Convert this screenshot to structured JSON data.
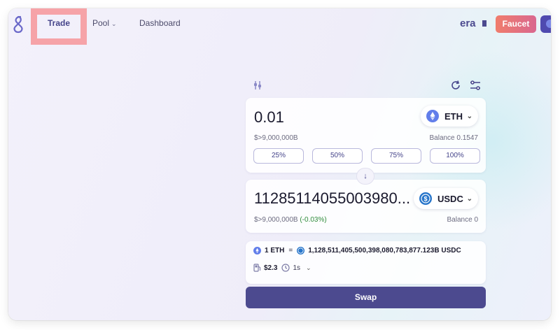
{
  "nav": {
    "items": [
      {
        "label": "Trade"
      },
      {
        "label": "Pool"
      },
      {
        "label": "Dashboard"
      }
    ],
    "faucet_label": "Faucet"
  },
  "swap": {
    "from": {
      "amount": "0.01",
      "token": "ETH",
      "usd_value": "$>9,000,000B",
      "balance_label": "Balance",
      "balance": "0.1547",
      "percent_buttons": [
        "25%",
        "50%",
        "75%",
        "100%"
      ]
    },
    "to": {
      "amount": "11285114055003980...",
      "token": "USDC",
      "usd_value": "$>9,000,000B",
      "price_impact": "(-0.03%)",
      "balance_label": "Balance",
      "balance": "0"
    },
    "rate": {
      "left": "1 ETH",
      "eq": "=",
      "right": "1,128,511,405,500,398,080,783,877.123B USDC"
    },
    "fee": "$2.3",
    "time": "1s",
    "button_label": "Swap"
  },
  "colors": {
    "accent": "#4c4a8f",
    "faucet_gradient_start": "#f07d6c",
    "faucet_gradient_end": "#d9678f",
    "eth": "#627eea",
    "usdc": "#2775ca",
    "positive": "#2e8b3a"
  },
  "icons": [
    "logo-icon",
    "era-logo",
    "chevron-down-icon",
    "sliders-icon",
    "refresh-icon",
    "settings-icon",
    "eth-icon",
    "usdc-icon",
    "arrow-down-icon",
    "gas-icon",
    "clock-icon"
  ]
}
